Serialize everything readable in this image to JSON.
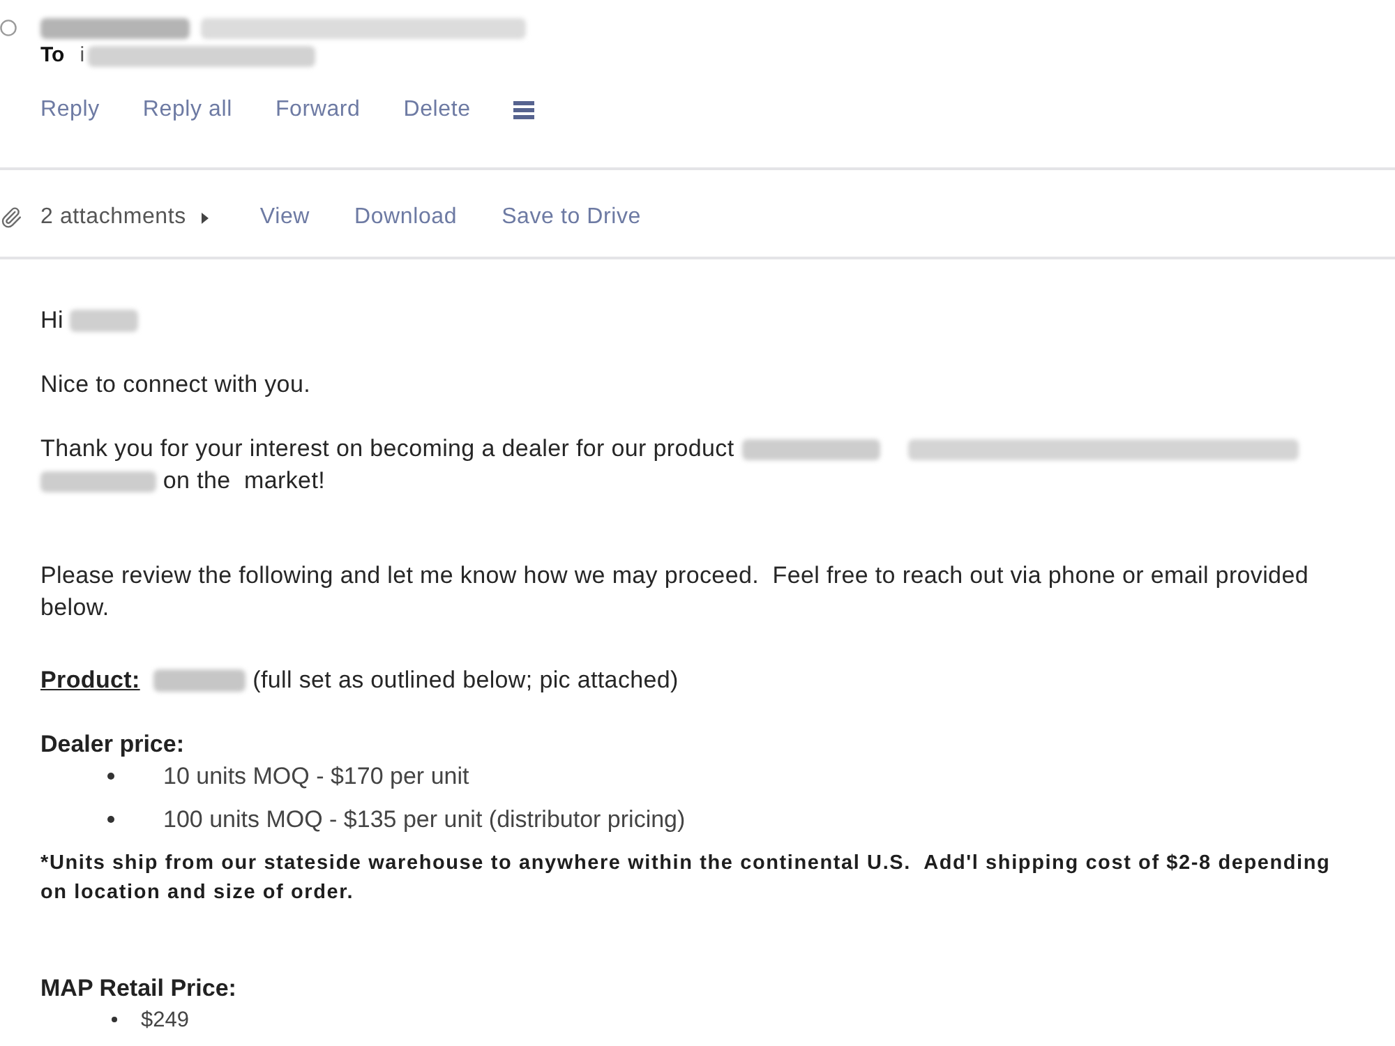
{
  "header": {
    "from": [
      {
        "kind": "redacted"
      },
      {
        "kind": "redacted"
      }
    ],
    "to": {
      "label": "To",
      "parts": [
        {
          "kind": "text",
          "text": "i"
        },
        {
          "kind": "redacted"
        }
      ]
    },
    "actions": [
      {
        "kind": "link",
        "label": "Reply"
      },
      {
        "kind": "link",
        "label": "Reply all"
      },
      {
        "kind": "link",
        "label": "Forward"
      },
      {
        "kind": "link",
        "label": "Delete"
      },
      {
        "kind": "menu"
      }
    ]
  },
  "attachments": {
    "label": "2 attachments",
    "expanded": false,
    "actions": [
      "View",
      "Download",
      "Save to Drive"
    ]
  },
  "body": [
    {
      "kind": "paragraph",
      "parts": [
        {
          "kind": "text",
          "text": "Hi"
        },
        {
          "kind": "redacted"
        }
      ]
    },
    {
      "kind": "paragraph",
      "parts": [
        {
          "kind": "text",
          "text": "Nice to connect with you."
        }
      ]
    },
    {
      "kind": "paragraph",
      "parts": [
        {
          "kind": "text",
          "text": "Thank you for your interest on becoming a dealer for our product"
        },
        {
          "kind": "redacted"
        },
        {
          "kind": "redacted"
        },
        {
          "kind": "redacted"
        },
        {
          "kind": "text",
          "text": "on the  market!"
        }
      ]
    },
    {
      "kind": "paragraph",
      "parts": [
        {
          "kind": "text",
          "text": "Please review the following and let me know how we may proceed.  Feel free to reach out via phone or email provided below."
        }
      ]
    },
    {
      "kind": "paragraph",
      "parts": [
        {
          "kind": "label",
          "text": "Product:"
        },
        {
          "kind": "redacted"
        },
        {
          "kind": "text",
          "text": "(full set as outlined below; pic attached)"
        }
      ]
    },
    {
      "kind": "heading",
      "text": "Dealer price:"
    },
    {
      "kind": "indentlist",
      "items": [
        "10 units MOQ - $170 per unit",
        "100 units MOQ - $135 per unit (distributor pricing)"
      ]
    },
    {
      "kind": "note",
      "text": "*Units ship from our stateside warehouse to anywhere within the continental U.S.  Add'l shipping cost of $2-8 depending on location and size of order."
    },
    {
      "kind": "heading",
      "text": "MAP Retail Price:"
    },
    {
      "kind": "list",
      "items": [
        "$249"
      ]
    }
  ]
}
